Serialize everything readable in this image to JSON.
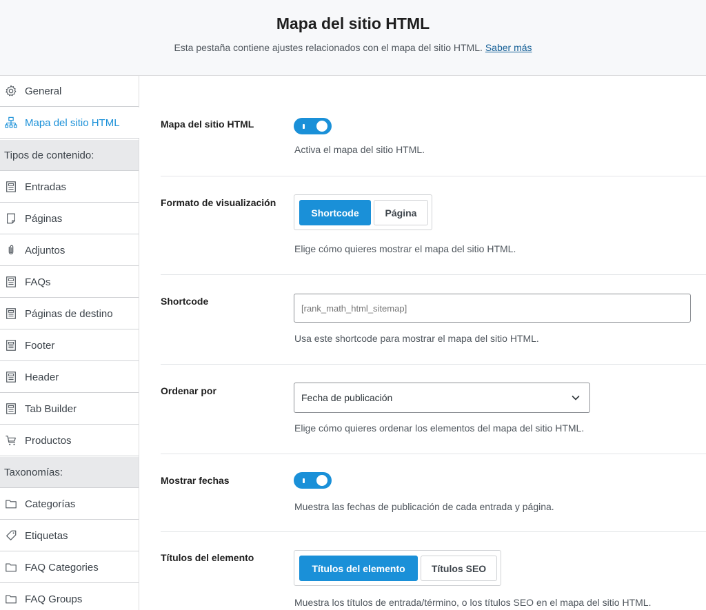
{
  "header": {
    "title": "Mapa del sitio HTML",
    "subtitle": "Esta pestaña contiene ajustes relacionados con el mapa del sitio HTML.",
    "learn_more": "Saber más"
  },
  "sidebar": {
    "items": [
      {
        "label": "General",
        "icon": "gear-icon"
      },
      {
        "label": "Mapa del sitio HTML",
        "icon": "sitemap-icon",
        "active": true
      }
    ],
    "group_content": "Tipos de contenido:",
    "content_items": [
      {
        "label": "Entradas",
        "icon": "post-icon"
      },
      {
        "label": "Páginas",
        "icon": "page-icon"
      },
      {
        "label": "Adjuntos",
        "icon": "paperclip-icon"
      },
      {
        "label": "FAQs",
        "icon": "post-icon"
      },
      {
        "label": "Páginas de destino",
        "icon": "post-icon"
      },
      {
        "label": "Footer",
        "icon": "post-icon"
      },
      {
        "label": "Header",
        "icon": "post-icon"
      },
      {
        "label": "Tab Builder",
        "icon": "post-icon"
      },
      {
        "label": "Productos",
        "icon": "cart-icon"
      }
    ],
    "group_taxonomies": "Taxonomías:",
    "taxonomy_items": [
      {
        "label": "Categorías",
        "icon": "folder-icon"
      },
      {
        "label": "Etiquetas",
        "icon": "tag-icon"
      },
      {
        "label": "FAQ Categories",
        "icon": "folder-icon"
      },
      {
        "label": "FAQ Groups",
        "icon": "folder-icon"
      }
    ]
  },
  "settings": {
    "sitemap": {
      "label": "Mapa del sitio HTML",
      "enabled": true,
      "desc": "Activa el mapa del sitio HTML."
    },
    "display_format": {
      "label": "Formato de visualización",
      "options": [
        "Shortcode",
        "Página"
      ],
      "selected": "Shortcode",
      "desc": "Elige cómo quieres mostrar el mapa del sitio HTML."
    },
    "shortcode": {
      "label": "Shortcode",
      "placeholder": "[rank_math_html_sitemap]",
      "desc": "Usa este shortcode para mostrar el mapa del sitio HTML."
    },
    "order_by": {
      "label": "Ordenar por",
      "value": "Fecha de publicación",
      "desc": "Elige cómo quieres ordenar los elementos del mapa del sitio HTML."
    },
    "show_dates": {
      "label": "Mostrar fechas",
      "enabled": true,
      "desc": "Muestra las fechas de publicación de cada entrada y página."
    },
    "item_titles": {
      "label": "Títulos del elemento",
      "options": [
        "Títulos del elemento",
        "Títulos SEO"
      ],
      "selected": "Títulos del elemento",
      "desc": "Muestra los títulos de entrada/término, o los títulos SEO en el mapa del sitio HTML."
    }
  },
  "colors": {
    "accent": "#1a90d8",
    "header_bg": "#f7f8fa",
    "group_bg": "#e8e9eb"
  }
}
